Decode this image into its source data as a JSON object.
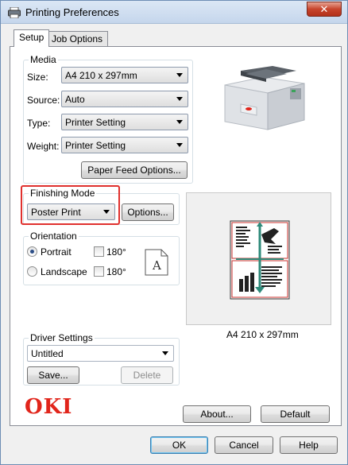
{
  "window": {
    "title": "Printing Preferences",
    "close_glyph": "✕"
  },
  "tabs": [
    {
      "label": "Setup"
    },
    {
      "label": "Job Options"
    }
  ],
  "media": {
    "group_label": "Media",
    "size_label": "Size:",
    "size_value": "A4 210 x 297mm",
    "source_label": "Source:",
    "source_value": "Auto",
    "type_label": "Type:",
    "type_value": "Printer Setting",
    "weight_label": "Weight:",
    "weight_value": "Printer Setting",
    "paper_feed_button": "Paper Feed Options..."
  },
  "finishing": {
    "group_label": "Finishing Mode",
    "value": "Poster Print",
    "options_button": "Options...",
    "highlight_color": "#e0312e"
  },
  "orientation": {
    "group_label": "Orientation",
    "portrait_label": "Portrait",
    "landscape_label": "Landscape",
    "rotate_label_1": "180°",
    "rotate_label_2": "180°",
    "selected": "Portrait",
    "page_letter": "A"
  },
  "preview": {
    "caption": "A4 210 x 297mm"
  },
  "driver": {
    "group_label": "Driver Settings",
    "value": "Untitled",
    "save_button": "Save...",
    "delete_button": "Delete"
  },
  "brand": {
    "logo_text": "OKI",
    "logo_color": "#e1251b"
  },
  "footer": {
    "about_button": "About...",
    "default_button": "Default",
    "ok_button": "OK",
    "cancel_button": "Cancel",
    "help_button": "Help"
  },
  "icons": [
    "printer-app-icon",
    "close-icon",
    "printer-image",
    "page-portrait-icon",
    "poster-preview"
  ]
}
